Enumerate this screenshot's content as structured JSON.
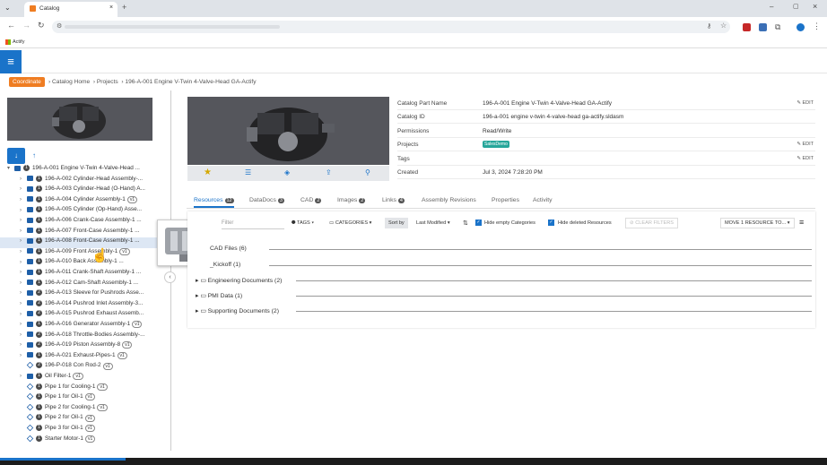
{
  "browser": {
    "tab_title": "Catalog",
    "bookmark": "Actify"
  },
  "breadcrumb": {
    "home_button": "Coordinate",
    "items": [
      "Catalog Home",
      "Projects",
      "196-A-001 Engine V-Twin 4-Valve-Head GA-Actify"
    ]
  },
  "tree": [
    {
      "label": "196-A-001 Engine V-Twin 4-Valve-Head ...",
      "n": "1",
      "kind": "fold",
      "indent": 0,
      "caret": "▾"
    },
    {
      "label": "196-A-002 Cylinder-Head Assembly-...",
      "n": "1",
      "kind": "fold",
      "indent": 1,
      "caret": "›"
    },
    {
      "label": "196-A-003 Cylinder-Head (O-Hand) A...",
      "n": "1",
      "kind": "fold",
      "indent": 1,
      "caret": "›"
    },
    {
      "label": "196-A-004 Cylinder Assembly-1",
      "n": "1",
      "kind": "fold",
      "indent": 1,
      "caret": "›",
      "badge": "v1"
    },
    {
      "label": "196-A-005 Cylinder (Op-Hand) Asse...",
      "n": "1",
      "kind": "fold",
      "indent": 1,
      "caret": "›"
    },
    {
      "label": "196-A-006 Crank-Case Assembly-1 ...",
      "n": "1",
      "kind": "fold",
      "indent": 1,
      "caret": "›"
    },
    {
      "label": "196-A-007 Front-Case Assembly-1 ...",
      "n": "1",
      "kind": "fold",
      "indent": 1,
      "caret": "›"
    },
    {
      "label": "196-A-008 Front-Case Assembly-1 ...",
      "n": "1",
      "kind": "fold",
      "indent": 1,
      "caret": "›",
      "hl": true
    },
    {
      "label": "196-A-009 Front Assembly-1",
      "n": "1",
      "kind": "fold",
      "indent": 1,
      "caret": "›",
      "badge": "v1"
    },
    {
      "label": "196-A-010 Back Assembly-1 ...",
      "n": "1",
      "kind": "fold",
      "indent": 1,
      "caret": "›"
    },
    {
      "label": "196-A-011 Crank-Shaft Assembly-1 ...",
      "n": "1",
      "kind": "fold",
      "indent": 1,
      "caret": "›"
    },
    {
      "label": "196-A-012 Cam-Shaft Assembly-1 ...",
      "n": "1",
      "kind": "fold",
      "indent": 1,
      "caret": "›"
    },
    {
      "label": "196-A-013 Sleeve for Pushrods Asse...",
      "n": "2",
      "kind": "fold",
      "indent": 1,
      "caret": "›"
    },
    {
      "label": "196-A-014 Pushrod Inlet Assembly-3...",
      "n": "2",
      "kind": "fold",
      "indent": 1,
      "caret": "›"
    },
    {
      "label": "196-A-015 Pushrod Exhaust Assemb...",
      "n": "2",
      "kind": "fold",
      "indent": 1,
      "caret": "›"
    },
    {
      "label": "196-A-016 Generator Assembly-1",
      "n": "1",
      "kind": "fold",
      "indent": 1,
      "caret": "›",
      "badge": "v1"
    },
    {
      "label": "196-A-018 Throttle-Bodies Assembly-...",
      "n": "2",
      "kind": "fold",
      "indent": 1,
      "caret": "›"
    },
    {
      "label": "196-A-019 Piston Assembly-8",
      "n": "2",
      "kind": "fold",
      "indent": 1,
      "caret": "›",
      "badge": "v1"
    },
    {
      "label": "196-A-021 Exhaust-Pipes-1",
      "n": "1",
      "kind": "fold",
      "indent": 1,
      "caret": "›",
      "badge": "v1"
    },
    {
      "label": "196-P-018 Con Rod-2",
      "n": "2",
      "kind": "cube",
      "indent": 1,
      "caret": "",
      "badge": "v1"
    },
    {
      "label": "Oil Filter-1",
      "n": "1",
      "kind": "fold",
      "indent": 1,
      "caret": "›",
      "badge": "v1"
    },
    {
      "label": "Pipe 1 for Cooling-1",
      "n": "1",
      "kind": "cube",
      "indent": 1,
      "caret": "",
      "badge": "v1"
    },
    {
      "label": "Pipe 1 for Oil-1",
      "n": "1",
      "kind": "cube",
      "indent": 1,
      "caret": "",
      "badge": "v1"
    },
    {
      "label": "Pipe 2 for Cooling-1",
      "n": "1",
      "kind": "cube",
      "indent": 1,
      "caret": "",
      "badge": "v1"
    },
    {
      "label": "Pipe 2 for Oil-1",
      "n": "1",
      "kind": "cube",
      "indent": 1,
      "caret": "",
      "badge": "v1"
    },
    {
      "label": "Pipe 3 for Oil-1",
      "n": "1",
      "kind": "cube",
      "indent": 1,
      "caret": "",
      "badge": "v1"
    },
    {
      "label": "Starter Motor-1",
      "n": "1",
      "kind": "cube",
      "indent": 1,
      "caret": "",
      "badge": "v1"
    }
  ],
  "props": [
    {
      "k": "Catalog Part Name",
      "v": "196-A-001 Engine V-Twin 4-Valve-Head GA-Actify",
      "e": "✎ EDIT"
    },
    {
      "k": "Catalog ID",
      "v": "196-a-001 engine v-twin 4-valve-head ga-actify.sldasm",
      "e": ""
    },
    {
      "k": "Permissions",
      "v": "Read/Write",
      "e": ""
    },
    {
      "k": "Projects",
      "v": "",
      "e": "✎ EDIT",
      "tag": "SalesDemo"
    },
    {
      "k": "Tags",
      "v": "",
      "e": "✎ EDIT"
    },
    {
      "k": "Created",
      "v": "Jul 3, 2024 7:28:20 PM",
      "e": ""
    }
  ],
  "tabs": [
    {
      "label": "Resources",
      "count": "12",
      "active": true
    },
    {
      "label": "DataDocs",
      "count": "3"
    },
    {
      "label": "CAD",
      "count": "2"
    },
    {
      "label": "Images",
      "count": "2"
    },
    {
      "label": "Links",
      "count": "4"
    },
    {
      "label": "Assembly Revisions",
      "count": ""
    },
    {
      "label": "Properties",
      "count": ""
    },
    {
      "label": "Activity",
      "count": ""
    }
  ],
  "toolbar": {
    "filter_placeholder": "Filter",
    "tags": "TAGS",
    "categories": "CATEGORIES",
    "sort_by": "Sort by",
    "sort_value": "Last Modified",
    "empty_categories": "Hide empty Categories",
    "deleted_resources": "Hide deleted Resources",
    "clear_filters": "CLEAR FILTERS",
    "move": "MOVE 1 RESOURCE TO..."
  },
  "categories": [
    {
      "label": "CAD Files (6)"
    },
    {
      "label": "_Kickoff (1)"
    },
    {
      "label": "Engineering Documents (2)"
    },
    {
      "label": "PMI Data (1)"
    },
    {
      "label": "Supporting Documents (2)"
    }
  ],
  "colors": {
    "accent": "#1a73c9",
    "orange": "#ef7d22",
    "tag_green": "#26a69a"
  }
}
